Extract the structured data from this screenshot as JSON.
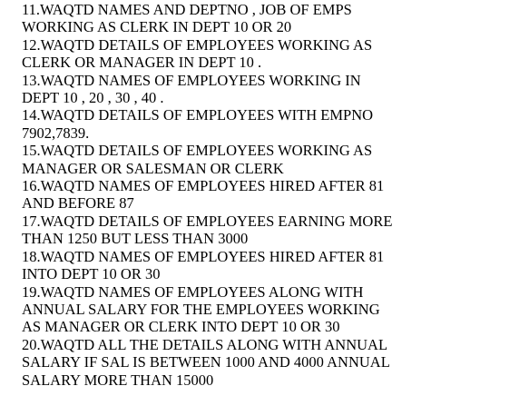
{
  "questions": [
    {
      "lines": [
        "11.WAQTD NAMES AND DEPTNO , JOB OF EMPS",
        "WORKING AS CLERK IN DEPT 10 OR 20"
      ]
    },
    {
      "lines": [
        "12.WAQTD DETAILS OF EMPLOYEES WORKING AS",
        "CLERK OR MANAGER IN DEPT 10 ."
      ]
    },
    {
      "lines": [
        "13.WAQTD NAMES OF EMPLOYEES WORKING IN",
        "DEPT 10 , 20 , 30 , 40 ."
      ]
    },
    {
      "lines": [
        "14.WAQTD DETAILS OF EMPLOYEES WITH EMPNO",
        "7902,7839."
      ]
    },
    {
      "lines": [
        "15.WAQTD DETAILS OF EMPLOYEES WORKING AS",
        "MANAGER OR SALESMAN OR CLERK"
      ]
    },
    {
      "lines": [
        "16.WAQTD NAMES OF EMPLOYEES HIRED AFTER 81",
        "AND BEFORE 87"
      ]
    },
    {
      "lines": [
        "17.WAQTD DETAILS OF EMPLOYEES EARNING MORE",
        "THAN 1250 BUT LESS THAN 3000"
      ]
    },
    {
      "lines": [
        "18.WAQTD NAMES OF EMPLOYEES HIRED AFTER 81",
        "INTO DEPT 10 OR 30"
      ]
    },
    {
      "lines": [
        "19.WAQTD NAMES OF EMPLOYEES ALONG WITH",
        "ANNUAL SALARY FOR THE EMPLOYEES WORKING",
        "AS MANAGER OR CLERK INTO DEPT 10 OR 30"
      ]
    },
    {
      "lines": [
        "20.WAQTD ALL THE DETAILS ALONG WITH ANNUAL",
        "SALARY IF SAL IS BETWEEN 1000 AND 4000 ANNUAL",
        "SALARY MORE THAN 15000"
      ]
    }
  ]
}
